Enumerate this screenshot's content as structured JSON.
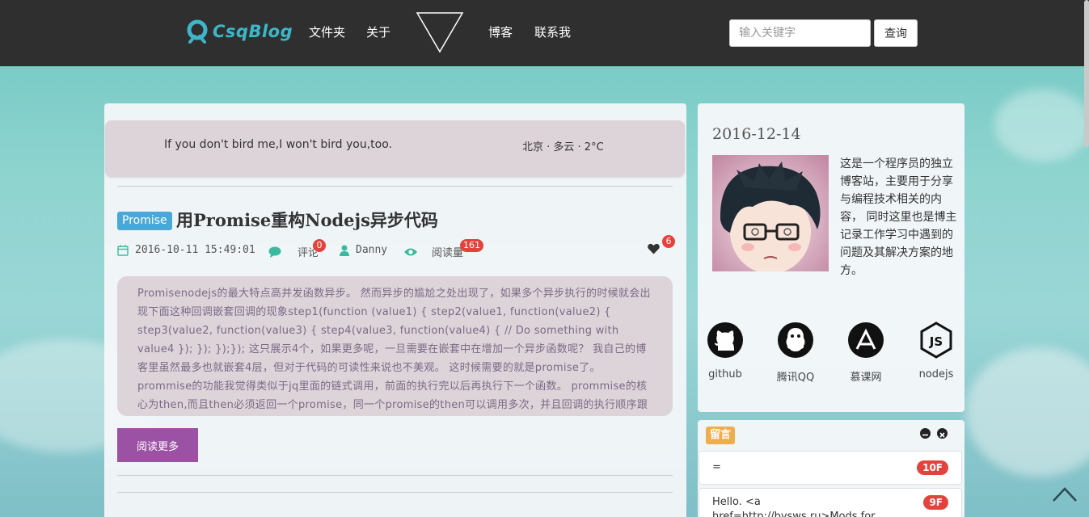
{
  "header": {
    "logo_text": "CsqBlog",
    "nav": [
      "文件夹",
      "关于",
      "博客",
      "联系我"
    ],
    "search_placeholder": "输入关键字",
    "search_button": "查询"
  },
  "banner": {
    "motto": "If you don't bird me,I won't bird you,too.",
    "weather": "北京 · 多云 · 2°C"
  },
  "post": {
    "tag": "Promise",
    "title": "用Promise重构Nodejs异步代码",
    "date": "2016-10-11 15:49:01",
    "comment_label": "评论",
    "comment_count": "0",
    "author": "Danny",
    "views_label": "阅读量",
    "views_count": "161",
    "likes": "6",
    "excerpt": " Promisenodejs的最大特点高并发函数异步。 然而异步的尴尬之处出现了，如果多个异步执行的时候就会出现下面这种回调嵌套回调的现象step1(function (value1) { step2(value1, function(value2) { step3(value2, function(value3) { step4(value3, function(value4) { // Do something with value4 }); }); });}); 这只展示4个，如果更多呢，一旦需要在嵌套中在增加一个异步函数呢？ 我自己的博客里虽然最多也就嵌套4层，但对于代码的可读性来说也不美观。 这时候需要的就是promise了。 prommise的功能我觉得类似于jq里面的链式调用，前面的执行完以后再执行下一个函数。 prommise的核心为then,而且then必须返回一个promise，同一个promise的then可以调用多次，并且回调的执行顺序跟它们被注册的顺序一致。",
    "read_more": "阅读更多"
  },
  "profile": {
    "date": "2016-12-14",
    "bio": "这是一个程序员的独立博客站，主要用于分享与编程技术相关的内容， 同时这里也是博主记录工作学习中遇到的问题及其解决方案的地方。",
    "social": [
      {
        "label": "github",
        "icon": "github-icon"
      },
      {
        "label": "腾讯QQ",
        "icon": "qq-icon"
      },
      {
        "label": "慕课网",
        "icon": "imooc-icon"
      },
      {
        "label": "nodejs",
        "icon": "nodejs-icon"
      }
    ]
  },
  "messages": {
    "tag": "留言",
    "items": [
      {
        "text": "=",
        "floor": "10F"
      },
      {
        "text": "Hello.  <a href=http://bysws.ru>Mods for XRumer</a>. Mod XRumer for",
        "floor": "9F"
      }
    ]
  },
  "colors": {
    "header_bg": "#2f2f2f",
    "accent_teal": "#3bb9a0",
    "read_more_bg": "#9c52a4",
    "badge_red": "#e2433d",
    "tag_blue": "#4aa8d8",
    "msg_tag": "#f0ad4e"
  }
}
